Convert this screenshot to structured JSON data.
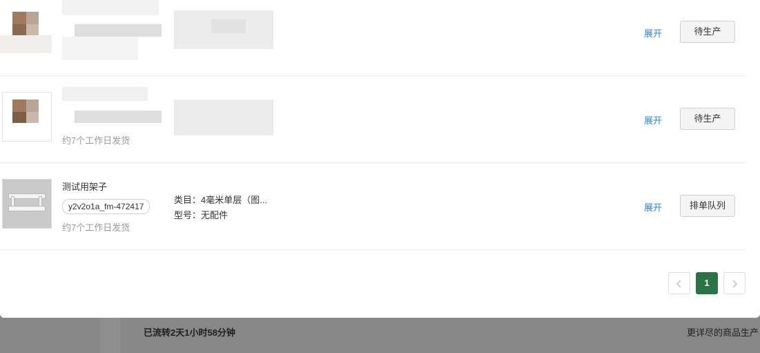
{
  "backdrop": {
    "elapsed_text": "已流转2天1小时58分钟",
    "right_text": "更详尽的商品生产"
  },
  "items": [
    {
      "expand_label": "展开",
      "status_label": "待生产"
    },
    {
      "ship_text": "约7个工作日发货",
      "expand_label": "展开",
      "status_label": "待生产"
    },
    {
      "name": "测试用架子",
      "sku": "y2v2o1a_fm-472417",
      "ship_text": "约7个工作日发货",
      "category_label": "类目：",
      "category_value": "4毫米单层（图...",
      "model_label": "型号：",
      "model_value": "无配件",
      "expand_label": "展开",
      "status_label": "排单队列"
    }
  ],
  "pagination": {
    "prev_icon": "chevron-left-icon",
    "current_page": "1",
    "next_icon": "chevron-right-icon"
  },
  "colors": {
    "link": "#2b86d6",
    "pager_active": "#2a7346",
    "overlay": "#878787"
  }
}
